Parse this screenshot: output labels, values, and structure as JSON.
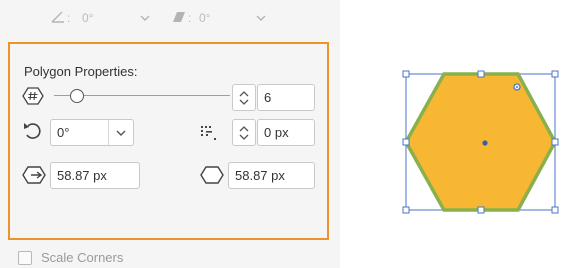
{
  "top_row": {
    "angle_label": ":",
    "angle_value": "0°",
    "shear_label": ":",
    "shear_value": "0°"
  },
  "polygon": {
    "title": "Polygon Properties:",
    "sides_value": "6",
    "sides_slider_position": 0.1,
    "rotation_value": "0°",
    "corner_radius_value": "0 px",
    "width_value": "58.87 px",
    "height_value": "58.87 px"
  },
  "scale_corners": {
    "label": "Scale Corners",
    "checked": false
  },
  "colors": {
    "panel_bg": "#f5f5f5",
    "highlight_border": "#f0922a",
    "shape_fill": "#f7b733",
    "shape_stroke": "#8ab04c",
    "selection": "#4a76c8"
  },
  "icons": {
    "angle": "angle-icon",
    "shear": "shear-icon",
    "sides": "hash-polygon-icon",
    "rotate": "rotate-ccw-icon",
    "corner_radius": "corner-radius-icon",
    "width": "hexagon-width-icon",
    "height": "hexagon-outline-icon"
  }
}
